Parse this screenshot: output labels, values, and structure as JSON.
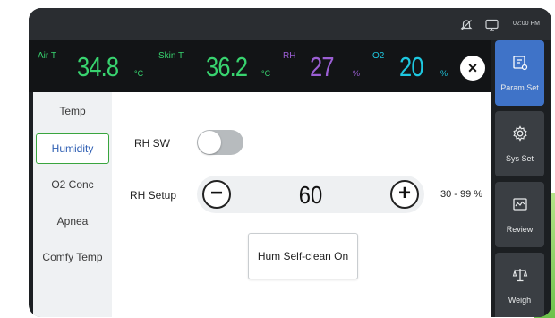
{
  "statusbar": {
    "alarm_icon": "alarm-off-icon",
    "monitor_icon": "monitor-icon",
    "time": "02:00 PM"
  },
  "vitals": [
    {
      "label": "Air T",
      "value": "34.8",
      "unit": "°C",
      "color": "#38d36f"
    },
    {
      "label": "Skin T",
      "value": "36.2",
      "unit": "°C",
      "color": "#38d36f"
    },
    {
      "label": "RH",
      "value": "27",
      "unit": "%",
      "color": "#9b5fd4"
    },
    {
      "label": "O2",
      "value": "20",
      "unit": "%",
      "color": "#1ec8e0"
    }
  ],
  "close_icon": "close-icon",
  "right_nav": [
    {
      "label": "Param Set",
      "icon": "param-set-icon",
      "active": true
    },
    {
      "label": "Sys Set",
      "icon": "gear-icon",
      "active": false
    },
    {
      "label": "Review",
      "icon": "review-icon",
      "active": false
    },
    {
      "label": "Weigh",
      "icon": "scale-icon",
      "active": false
    }
  ],
  "left_menu": [
    {
      "label": "Temp",
      "active": false
    },
    {
      "label": "Humidity",
      "active": true
    },
    {
      "label": "O2 Conc",
      "active": false
    },
    {
      "label": "Apnea",
      "active": false
    },
    {
      "label": "Comfy Temp",
      "active": false
    }
  ],
  "humidity": {
    "rh_sw_label": "RH SW",
    "rh_sw_on": false,
    "rh_setup_label": "RH Setup",
    "rh_setup_value": "60",
    "range": "30 - 99 %",
    "minus_icon": "minus-icon",
    "plus_icon": "plus-icon",
    "selfclean_label": "Hum Self-clean On"
  },
  "colors": {
    "active_nav": "#3f73c8",
    "active_menu_border": "#39a53e",
    "active_menu_text": "#2f5fb3"
  }
}
